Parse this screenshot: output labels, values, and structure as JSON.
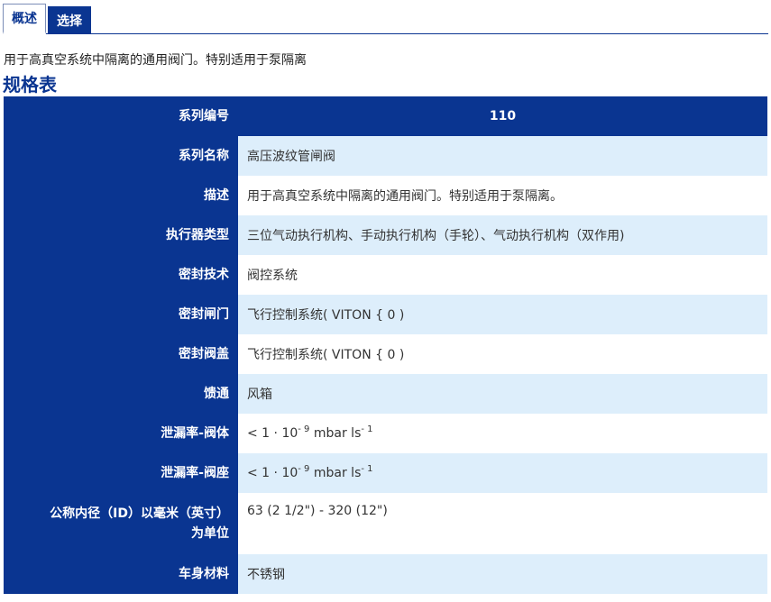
{
  "tabs": [
    {
      "label": "概述",
      "active": true
    },
    {
      "label": "选择",
      "active": false
    }
  ],
  "intro": "用于高真空系统中隔离的通用阀门。特别适用于泵隔离",
  "section_title": "规格表",
  "specs": {
    "series_number": {
      "label": "系列编号",
      "value": "110"
    },
    "series_name": {
      "label": "系列名称",
      "value": "高压波纹管闸阀"
    },
    "description": {
      "label": "描述",
      "value": "用于高真空系统中隔离的通用阀门。特别适用于泵隔离。"
    },
    "actuator_type": {
      "label": "执行器类型",
      "value": "三位气动执行机构、手动执行机构（手轮）、气动执行机构（双作用)"
    },
    "sealing_technology": {
      "label": "密封技术",
      "value": "阀控系统"
    },
    "gate_seal": {
      "label": "密封闸门",
      "value": "飞行控制系统( VITON { 0 )"
    },
    "bonnet_seal": {
      "label": "密封阀盖",
      "value": "飞行控制系统( VITON { 0 )"
    },
    "feedthrough": {
      "label": "馈通",
      "value": "风箱"
    },
    "leak_rate_body": {
      "label": "泄漏率-阀体",
      "prefix": "< 1 · 10",
      "exp1": "- 9",
      "unit": "mbar ls",
      "exp2": "- 1"
    },
    "leak_rate_seat": {
      "label": "泄漏率-阀座",
      "prefix": "< 1 · 10",
      "exp1": "- 9",
      "unit": "mbar ls",
      "exp2": "- 1"
    },
    "nominal_id": {
      "label_line1": "公称内径（ID）以毫米（英寸）",
      "label_line2": "为单位",
      "value": "63 (2 1/2\") - 320 (12\")"
    },
    "body_material": {
      "label": "车身材料",
      "value": "不锈钢"
    }
  }
}
